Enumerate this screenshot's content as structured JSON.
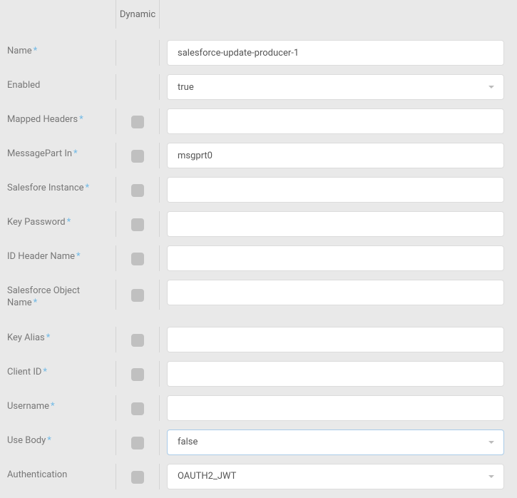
{
  "columns": {
    "dynamic_header": "Dynamic"
  },
  "fields": {
    "name": {
      "label": "Name",
      "required": true,
      "value": "salesforce-update-producer-1",
      "has_checkbox": false,
      "type": "text"
    },
    "enabled": {
      "label": "Enabled",
      "required": false,
      "value": "true",
      "has_checkbox": false,
      "type": "select"
    },
    "mapped_headers": {
      "label": "Mapped Headers",
      "required": true,
      "value": "",
      "has_checkbox": true,
      "type": "text"
    },
    "messagepart_in": {
      "label": "MessagePart In",
      "required": true,
      "value": "msgprt0",
      "has_checkbox": true,
      "type": "text"
    },
    "salesforce_instance": {
      "label": "Salesfore Instance",
      "required": true,
      "value": "",
      "has_checkbox": true,
      "type": "text"
    },
    "key_password": {
      "label": "Key Password",
      "required": true,
      "value": "",
      "has_checkbox": true,
      "type": "text"
    },
    "id_header_name": {
      "label": "ID Header Name",
      "required": true,
      "value": "",
      "has_checkbox": true,
      "type": "text"
    },
    "salesforce_object_name": {
      "label": "Salesforce Object Name",
      "required": true,
      "value": "",
      "has_checkbox": true,
      "type": "text"
    },
    "key_alias": {
      "label": "Key Alias",
      "required": true,
      "value": "",
      "has_checkbox": true,
      "type": "text"
    },
    "client_id": {
      "label": "Client ID",
      "required": true,
      "value": "",
      "has_checkbox": true,
      "type": "text"
    },
    "username": {
      "label": "Username",
      "required": true,
      "value": "",
      "has_checkbox": true,
      "type": "text"
    },
    "use_body": {
      "label": "Use Body",
      "required": true,
      "value": "false",
      "has_checkbox": true,
      "type": "select",
      "highlighted": true
    },
    "authentication": {
      "label": "Authentication",
      "required": false,
      "value": "OAUTH2_JWT",
      "has_checkbox": true,
      "type": "select"
    }
  }
}
